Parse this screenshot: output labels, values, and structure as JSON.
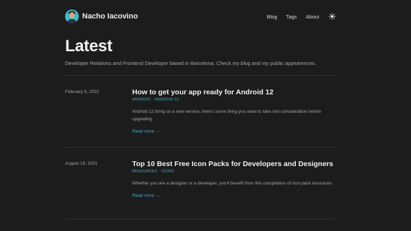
{
  "header": {
    "site_name": "Nacho Iacovino",
    "nav": [
      {
        "label": "Blog"
      },
      {
        "label": "Tags"
      },
      {
        "label": "About"
      }
    ],
    "theme_toggle_icon": "sun-icon"
  },
  "main": {
    "title": "Latest",
    "intro": "Developer Relations and Frontend Developer based in Barcelona. Check my blog and my public appearences."
  },
  "posts": [
    {
      "date": "February 8, 2022",
      "title": "How to get your app ready for Android 12",
      "tags": [
        "ANDROID",
        "ANDROID-12"
      ],
      "summary": "Android 12 bring us a new version, here's some thing you need to take into consideration before upgrading.",
      "read_more": "Read more →"
    },
    {
      "date": "August 19, 2021",
      "title": "Top 10 Best Free Icon Packs for Developers and Designers",
      "tags": [
        "RESOURCES",
        "ICONS"
      ],
      "summary": "Whether you are a designer or a developer, you'll benefit from this compilation of icon pack resources.",
      "read_more": "Read more →"
    }
  ],
  "colors": {
    "background": "#1d1c1d",
    "accent": "#3fb0c2",
    "muted_text": "#a6a6a6"
  }
}
